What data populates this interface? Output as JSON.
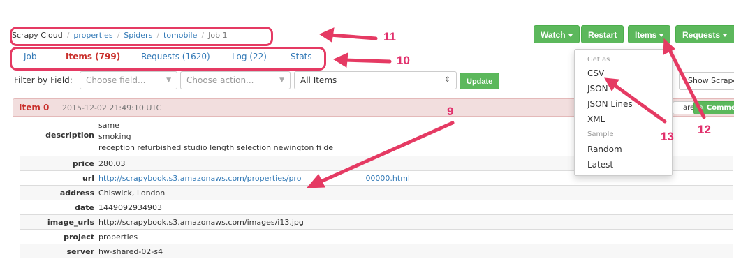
{
  "breadcrumb": [
    "Scrapy Cloud",
    "properties",
    "Spiders",
    "tomobile",
    "Job 1"
  ],
  "tabs": [
    {
      "label": "Job"
    },
    {
      "label": "Items (799)"
    },
    {
      "label": "Requests (1620)"
    },
    {
      "label": "Log (22)"
    },
    {
      "label": "Stats"
    }
  ],
  "toolbar": {
    "watch_label": "Watch",
    "restart_label": "Restart",
    "items_label": "Items",
    "requests_label": "Requests"
  },
  "filter": {
    "label": "Filter by Field:",
    "field_placeholder": "Choose field...",
    "action_placeholder": "Choose action...",
    "scope_value": "All Items",
    "update_label": "Update",
    "show_scraped_label": "Show Scrape"
  },
  "item": {
    "title": "Item 0",
    "timestamp": "2015-12-02 21:49:10 UTC",
    "compare_label": "are",
    "comment_label": "Comme",
    "fields": {
      "description": {
        "key": "description",
        "lines": [
          "same",
          "smoking",
          "reception refurbished studio length selection newington fi de"
        ]
      },
      "price": {
        "key": "price",
        "value": "280.03"
      },
      "url": {
        "key": "url",
        "value": "http://scrapybook.s3.amazonaws.com/properties/pro"
      },
      "url_tail": "00000.html",
      "address": {
        "key": "address",
        "value": "Chiswick, London"
      },
      "date": {
        "key": "date",
        "value": "1449092934903"
      },
      "image_urls": {
        "key": "image_urls",
        "value": "http://scrapybook.s3.amazonaws.com/images/i13.jpg"
      },
      "project": {
        "key": "project",
        "value": "properties"
      },
      "server": {
        "key": "server",
        "value": "hw-shared-02-s4"
      }
    }
  },
  "items_menu": {
    "header_get_as": "Get as",
    "formats": [
      "CSV",
      "JSON",
      "JSON Lines",
      "XML"
    ],
    "header_sample": "Sample",
    "samples": [
      "Random",
      "Latest"
    ]
  },
  "annotations": {
    "n9": "9",
    "n10": "10",
    "n11": "11",
    "n12": "12",
    "n13": "13",
    "color": "#e53a63"
  },
  "colors": {
    "accent_green": "#5cb85c",
    "active_tab_red": "#c9302c",
    "link_blue": "#337ab7",
    "item_header_bg": "#f2dede"
  }
}
